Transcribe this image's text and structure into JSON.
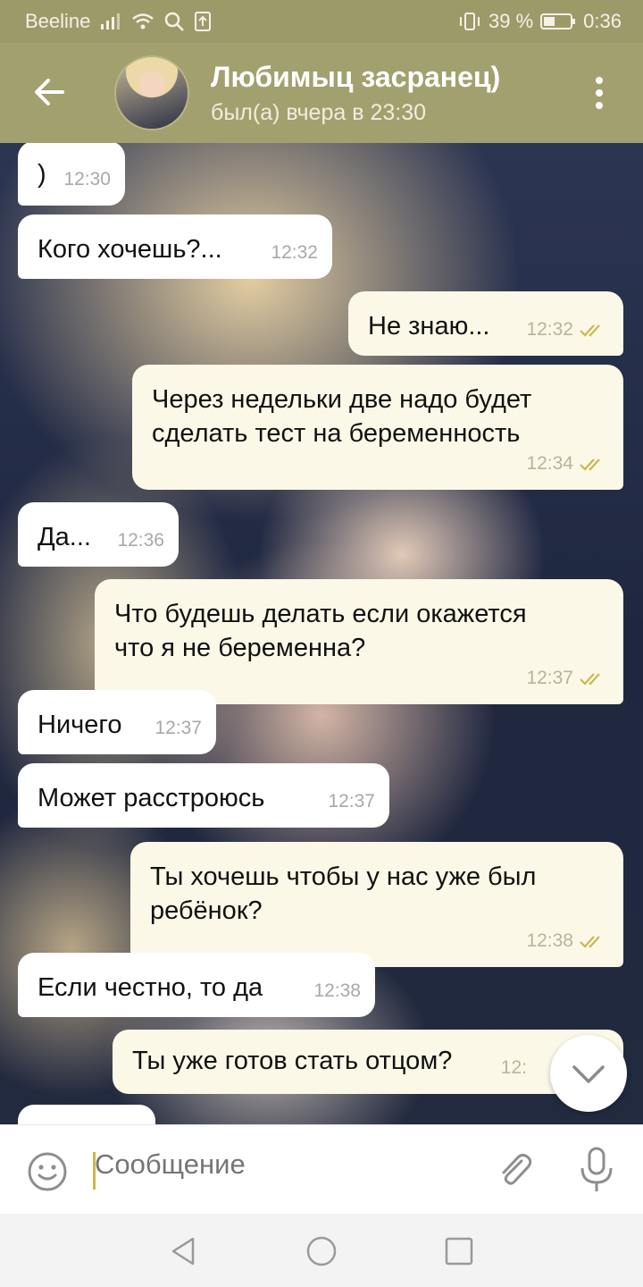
{
  "status_bar": {
    "carrier": "Beeline",
    "battery": "39 %",
    "time": "0:36"
  },
  "header": {
    "contact_name": "Любимыц засранец)",
    "last_seen": "был(а) вчера в 23:30"
  },
  "messages": [
    {
      "dir": "in",
      "text": ")",
      "time": "12:30"
    },
    {
      "dir": "in",
      "text": "Кого хочешь?...",
      "time": "12:32"
    },
    {
      "dir": "out",
      "text": "Не знаю...",
      "time": "12:32",
      "read": true
    },
    {
      "dir": "out",
      "lines": [
        "Через недельки две надо будет",
        "сделать тест на беременность"
      ],
      "time": "12:34",
      "read": true
    },
    {
      "dir": "in",
      "text": "Да...",
      "time": "12:36"
    },
    {
      "dir": "out",
      "lines": [
        "Что будешь делать если окажется",
        "что я не беременна?"
      ],
      "time": "12:37",
      "read": true
    },
    {
      "dir": "in",
      "text": "Ничего",
      "time": "12:37"
    },
    {
      "dir": "in",
      "text": "Может расстроюсь",
      "time": "12:37"
    },
    {
      "dir": "out",
      "lines": [
        "Ты хочешь чтобы у нас уже был",
        "ребёнок?"
      ],
      "time": "12:38",
      "read": true
    },
    {
      "dir": "in",
      "text": "Если честно, то да",
      "time": "12:38"
    },
    {
      "dir": "out",
      "text": "Ты уже готов стать отцом?",
      "time": "12:"
    }
  ],
  "input": {
    "placeholder": "Сообщение",
    "value": ""
  },
  "colors": {
    "header": "#a3a06f",
    "status_bar": "#9d9a6a",
    "outgoing_bubble": "#fbf8e8",
    "incoming_bubble": "#ffffff",
    "read_ticks": "#c9b94f"
  },
  "icons": [
    "back-arrow-icon",
    "more-vertical-icon",
    "double-check-icon",
    "chevron-down-icon",
    "smile-icon",
    "paperclip-icon",
    "microphone-icon",
    "nav-back-icon",
    "nav-home-icon",
    "nav-recents-icon"
  ]
}
